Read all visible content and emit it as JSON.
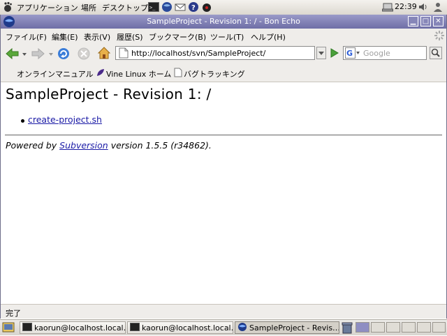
{
  "panel": {
    "menus": [
      "アプリケーション",
      "場所",
      "デスクトップ"
    ],
    "clock": "22:39"
  },
  "window": {
    "title": "SampleProject - Revision 1: / - Bon Echo"
  },
  "menubar": {
    "items": [
      "ファイル(F)",
      "編集(E)",
      "表示(V)",
      "履歴(S)",
      "ブックマーク(B)",
      "ツール(T)",
      "ヘルプ(H)"
    ]
  },
  "navbar": {
    "url": "http://localhost/svn/SampleProject/",
    "search_placeholder": "Google"
  },
  "bookmarks": [
    "オンラインマニュアル",
    "Vine Linux ホーム",
    "バグトラッキング"
  ],
  "page": {
    "heading": "SampleProject - Revision 1: /",
    "files": [
      "create-project.sh"
    ],
    "footer": {
      "prefix": "Powered by ",
      "link": "Subversion",
      "suffix": " version 1.5.5 (r34862)."
    }
  },
  "status": "完了",
  "taskbar": {
    "tasks": [
      "kaorun@localhost.local…",
      "kaorun@localhost.local…",
      "SampleProject - Revis…"
    ]
  },
  "colors": {
    "titlebar": "#7a7ab2",
    "link": "#1a1aa6",
    "chrome": "#efedea"
  }
}
